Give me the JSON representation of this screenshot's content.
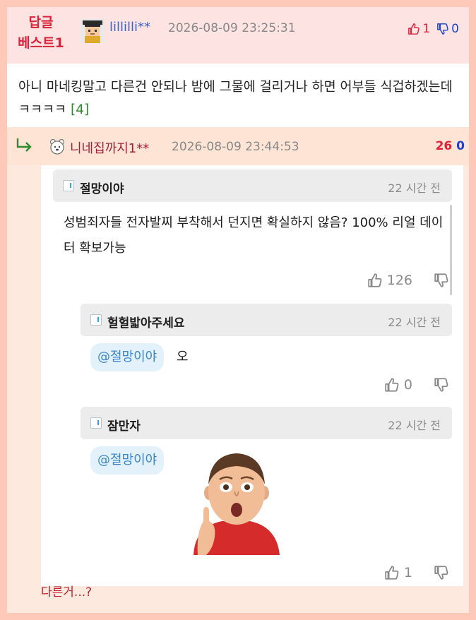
{
  "best": {
    "badge_line1": "답글",
    "badge_line2": "베스트1",
    "username": "lillilli**",
    "datetime": "2026-08-09 23:25:31",
    "up_count": "1",
    "down_count": "0",
    "text": "아니 마네킹말고 다른건 안되나 밤에 그물에 걸리거나 하면 어부들 식겁하겠는데 ㅋㅋㅋㅋ",
    "reply_count": "[4]"
  },
  "reply": {
    "username": "니네집까지1**",
    "datetime": "2026-08-09 23:44:53",
    "up_count": "26",
    "down_count": "0",
    "bottom_text": "다른거...?"
  },
  "embedded_comments": [
    {
      "name": "절망이야",
      "time": "22 시간 전",
      "text": "성범죄자들 전자발찌 부착해서 던지면 확실하지 않음? 100% 리얼 데이터 확보가능",
      "likes": "126"
    },
    {
      "name": "헐헐밟아주세요",
      "time": "22 시간 전",
      "mention": "@절망이야",
      "text": "오",
      "likes": "0"
    },
    {
      "name": "잠만자",
      "time": "22 시간 전",
      "mention": "@절망이야",
      "likes": "1",
      "image_icon": "surprised-kid-pointing-up"
    }
  ],
  "colors": {
    "accent_red": "#d9233a",
    "accent_blue": "#2044c9",
    "frame": "#ffc9ba"
  }
}
